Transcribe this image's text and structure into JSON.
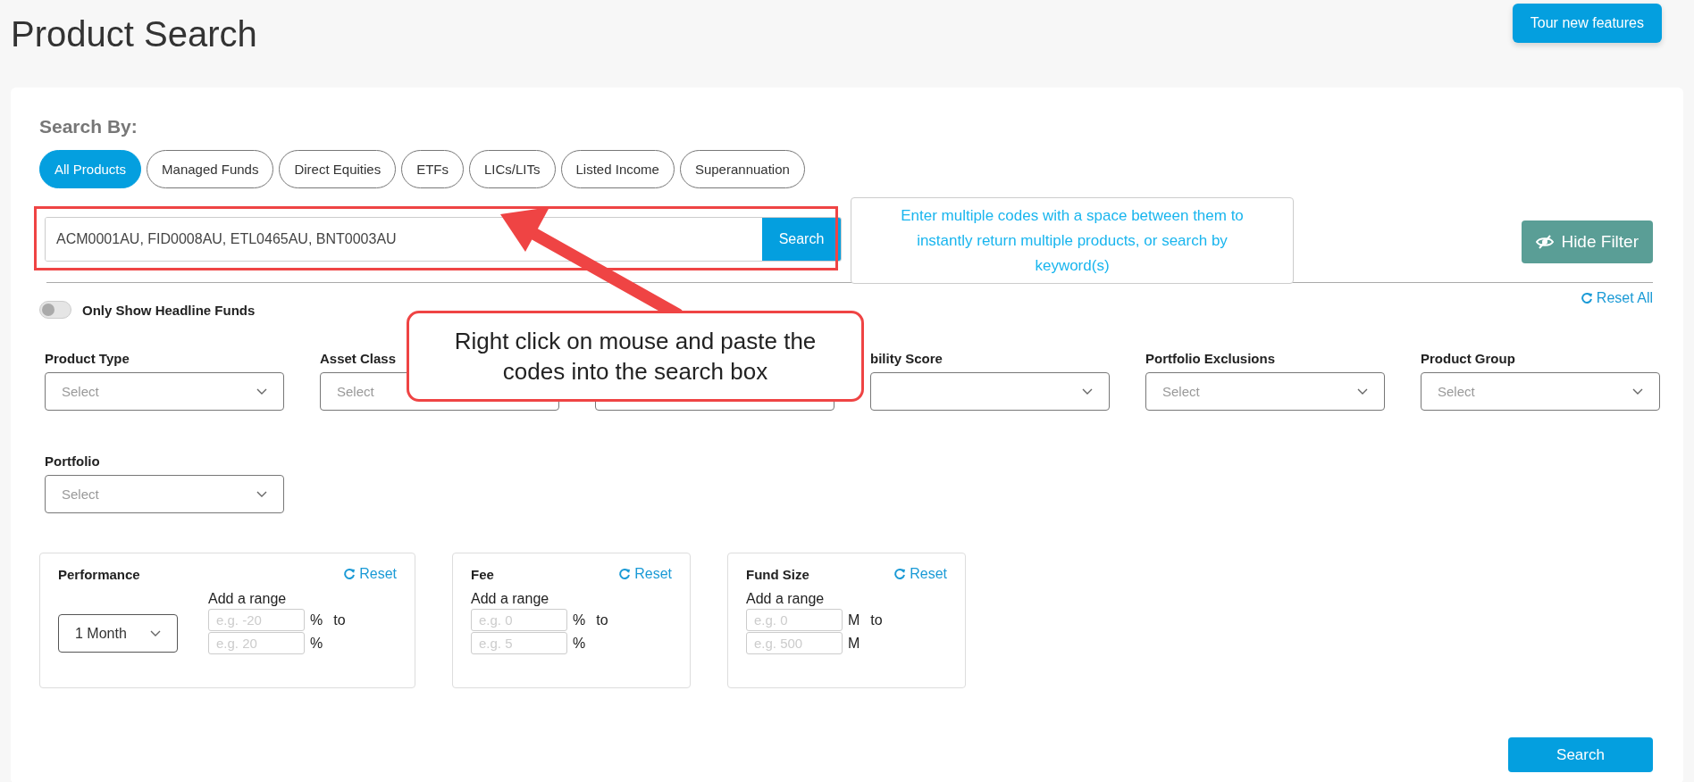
{
  "title": "Product Search",
  "tour_button": "Tour new features",
  "search_by": {
    "label": "Search By:",
    "categories": [
      {
        "label": "All Products",
        "selected": true
      },
      {
        "label": "Managed Funds",
        "selected": false
      },
      {
        "label": "Direct Equities",
        "selected": false
      },
      {
        "label": "ETFs",
        "selected": false
      },
      {
        "label": "LICs/LITs",
        "selected": false
      },
      {
        "label": "Listed Income",
        "selected": false
      },
      {
        "label": "Superannuation",
        "selected": false
      }
    ]
  },
  "search": {
    "value": "ACM0001AU, FID0008AU, ETL0465AU, BNT0003AU",
    "button": "Search"
  },
  "tooltip": "Enter multiple codes with a space between them to instantly return multiple products, or search by keyword(s)",
  "hide_filter": "Hide Filter",
  "reset_all": "Reset All",
  "headline_toggle": {
    "label": "Only Show Headline Funds",
    "on": false
  },
  "filters": [
    {
      "kind": "select",
      "label": "Product Type",
      "placeholder": "Select"
    },
    {
      "kind": "partial",
      "label": "Asset Class",
      "placeholder": "Select"
    },
    {
      "kind": "partial"
    },
    {
      "kind": "select",
      "label": "bility Score"
    },
    {
      "kind": "select",
      "label": "Portfolio Exclusions",
      "placeholder": "Select"
    },
    {
      "kind": "select",
      "label": "Product Group",
      "placeholder": "Select"
    },
    {
      "kind": "select",
      "label": "Portfolio",
      "placeholder": "Select"
    }
  ],
  "range_panels": [
    {
      "title": "Performance",
      "reset": "Reset",
      "period": "1 Month",
      "add_range": "Add a range",
      "rows": [
        {
          "placeholder": "e.g. -20",
          "unit": "%",
          "to": "to"
        },
        {
          "placeholder": "e.g. 20",
          "unit": "%"
        }
      ]
    },
    {
      "title": "Fee",
      "reset": "Reset",
      "add_range": "Add a range",
      "rows": [
        {
          "placeholder": "e.g. 0",
          "unit": "%",
          "to": "to"
        },
        {
          "placeholder": "e.g. 5",
          "unit": "%"
        }
      ]
    },
    {
      "title": "Fund Size",
      "reset": "Reset",
      "add_range": "Add a range",
      "rows": [
        {
          "placeholder": "e.g. 0",
          "unit": "M",
          "to": "to"
        },
        {
          "placeholder": "e.g. 500",
          "unit": "M"
        }
      ]
    }
  ],
  "search_button": "Search",
  "annotation": "Right click on mouse and paste the codes into the search box"
}
